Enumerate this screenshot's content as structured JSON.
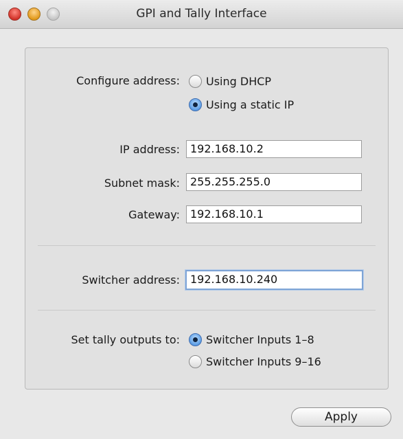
{
  "window": {
    "title": "GPI and Tally Interface"
  },
  "configure": {
    "label": "Configure address:",
    "options": [
      {
        "label": "Using DHCP",
        "selected": false
      },
      {
        "label": "Using a static IP",
        "selected": true
      }
    ]
  },
  "network": {
    "ip_label": "IP address:",
    "ip_value": "192.168.10.2",
    "subnet_label": "Subnet mask:",
    "subnet_value": "255.255.255.0",
    "gateway_label": "Gateway:",
    "gateway_value": "192.168.10.1"
  },
  "switcher": {
    "label": "Switcher address:",
    "value": "192.168.10.240"
  },
  "tally": {
    "label": "Set tally outputs to:",
    "options": [
      {
        "label": "Switcher Inputs 1–8",
        "selected": true
      },
      {
        "label": "Switcher Inputs 9–16",
        "selected": false
      }
    ]
  },
  "actions": {
    "apply_label": "Apply"
  }
}
